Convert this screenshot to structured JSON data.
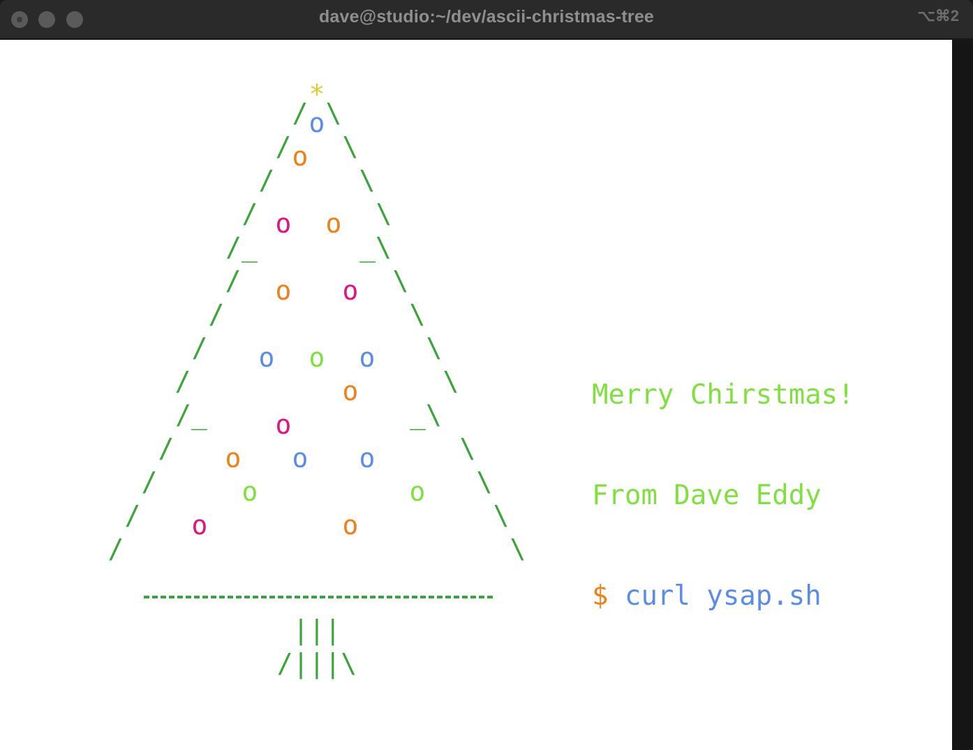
{
  "window": {
    "title": "dave@studio:~/dev/ascii-christmas-tree",
    "shortcut": "⌥⌘2"
  },
  "colors": {
    "tree_green": "#3ba53b",
    "star_yellow": "#d8d02a",
    "ornament_blue": "#5b8de8",
    "ornament_orange": "#f0801a",
    "ornament_pink": "#e0157f",
    "ornament_lime": "#7fe040"
  },
  "tree": {
    "star": "*",
    "trunk_top": "|||",
    "trunk_bottom": "/|||\\",
    "left_edges": [
      "/",
      "/",
      "/",
      "/",
      "/_",
      "/",
      "/",
      "/",
      "/",
      "/_",
      "/",
      "/",
      "/",
      "/"
    ],
    "right_edges": [
      "\\",
      "\\",
      "\\",
      "\\",
      "_\\",
      "\\",
      "\\",
      "\\",
      "\\",
      "_\\",
      "\\",
      "\\",
      "\\",
      "\\"
    ],
    "ornaments": [
      {
        "row": 1,
        "col": 18,
        "glyph": "o",
        "color": "ornament_blue"
      },
      {
        "row": 2,
        "col": 17,
        "glyph": "o",
        "color": "ornament_orange"
      },
      {
        "row": 4,
        "col": 16,
        "glyph": "o",
        "color": "ornament_pink"
      },
      {
        "row": 4,
        "col": 19,
        "glyph": "o",
        "color": "ornament_orange"
      },
      {
        "row": 6,
        "col": 16,
        "glyph": "o",
        "color": "ornament_orange"
      },
      {
        "row": 6,
        "col": 20,
        "glyph": "o",
        "color": "ornament_pink"
      },
      {
        "row": 8,
        "col": 15,
        "glyph": "o",
        "color": "ornament_blue"
      },
      {
        "row": 8,
        "col": 18,
        "glyph": "o",
        "color": "ornament_lime"
      },
      {
        "row": 8,
        "col": 21,
        "glyph": "o",
        "color": "ornament_blue"
      },
      {
        "row": 9,
        "col": 20,
        "glyph": "o",
        "color": "ornament_orange"
      },
      {
        "row": 10,
        "col": 16,
        "glyph": "o",
        "color": "ornament_pink"
      },
      {
        "row": 11,
        "col": 13,
        "glyph": "o",
        "color": "ornament_orange"
      },
      {
        "row": 11,
        "col": 17,
        "glyph": "o",
        "color": "ornament_blue"
      },
      {
        "row": 11,
        "col": 21,
        "glyph": "o",
        "color": "ornament_blue"
      },
      {
        "row": 12,
        "col": 14,
        "glyph": "o",
        "color": "ornament_lime"
      },
      {
        "row": 12,
        "col": 24,
        "glyph": "o",
        "color": "ornament_lime"
      },
      {
        "row": 13,
        "col": 11,
        "glyph": "o",
        "color": "ornament_pink"
      },
      {
        "row": 13,
        "col": 20,
        "glyph": "o",
        "color": "ornament_orange"
      }
    ]
  },
  "message": {
    "line1": "Merry Chirstmas!",
    "line2": "From Dave Eddy",
    "prompt": "$",
    "command": " curl ysap.sh",
    "line1_color": "#7fe040",
    "line2_color": "#7fe040",
    "prompt_color": "#f0801a",
    "command_color": "#5b8de8"
  }
}
